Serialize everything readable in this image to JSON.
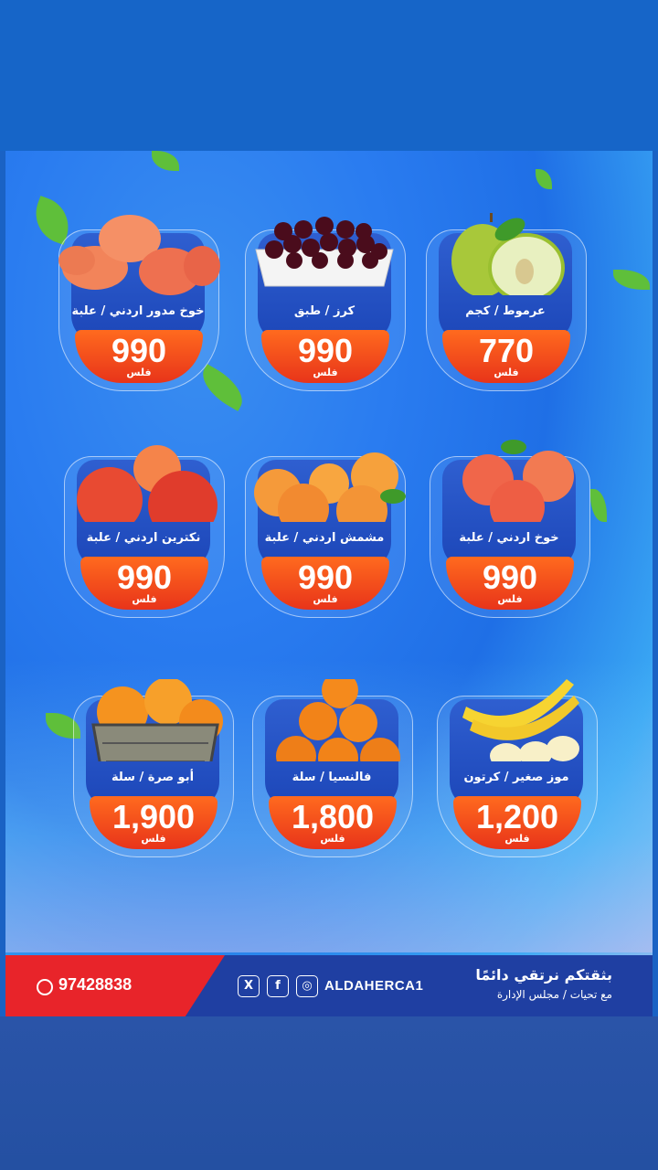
{
  "products": [
    {
      "name": "عرموط / كجم",
      "price": "770",
      "unit": "فلس",
      "fruit": "pear-image"
    },
    {
      "name": "كرز / طبق",
      "price": "990",
      "unit": "فلس",
      "fruit": "cherries-image"
    },
    {
      "name": "خوخ مدور اردني / علبة",
      "price": "990",
      "unit": "فلس",
      "fruit": "flat-peach-image"
    },
    {
      "name": "خوخ اردني / علبة",
      "price": "990",
      "unit": "فلس",
      "fruit": "peach-image"
    },
    {
      "name": "مشمش اردني / علبة",
      "price": "990",
      "unit": "فلس",
      "fruit": "apricot-image"
    },
    {
      "name": "نكترين اردني / علبة",
      "price": "990",
      "unit": "فلس",
      "fruit": "nectarine-image"
    },
    {
      "name": "موز صغير / كرتون",
      "price": "1,200",
      "unit": "فلس",
      "fruit": "banana-image"
    },
    {
      "name": "فالنسيا / سلة",
      "price": "1,800",
      "unit": "فلس",
      "fruit": "valencia-orange-image"
    },
    {
      "name": "أبو صرة / سلة",
      "price": "1,900",
      "unit": "فلس",
      "fruit": "navel-orange-basket-image"
    }
  ],
  "footer": {
    "phone": "97428838",
    "handle": "ALDAHERCA1",
    "slogan": "بثقتكم نرتقي دائمًا",
    "slogan_sub": "مع تحيات / مجلس الإدارة",
    "social_icons": [
      "x-icon",
      "facebook-icon",
      "instagram-icon"
    ]
  },
  "colors": {
    "price_pill": "#e8341a",
    "footer_blue": "#1f3fa2",
    "footer_red": "#e8242a"
  }
}
